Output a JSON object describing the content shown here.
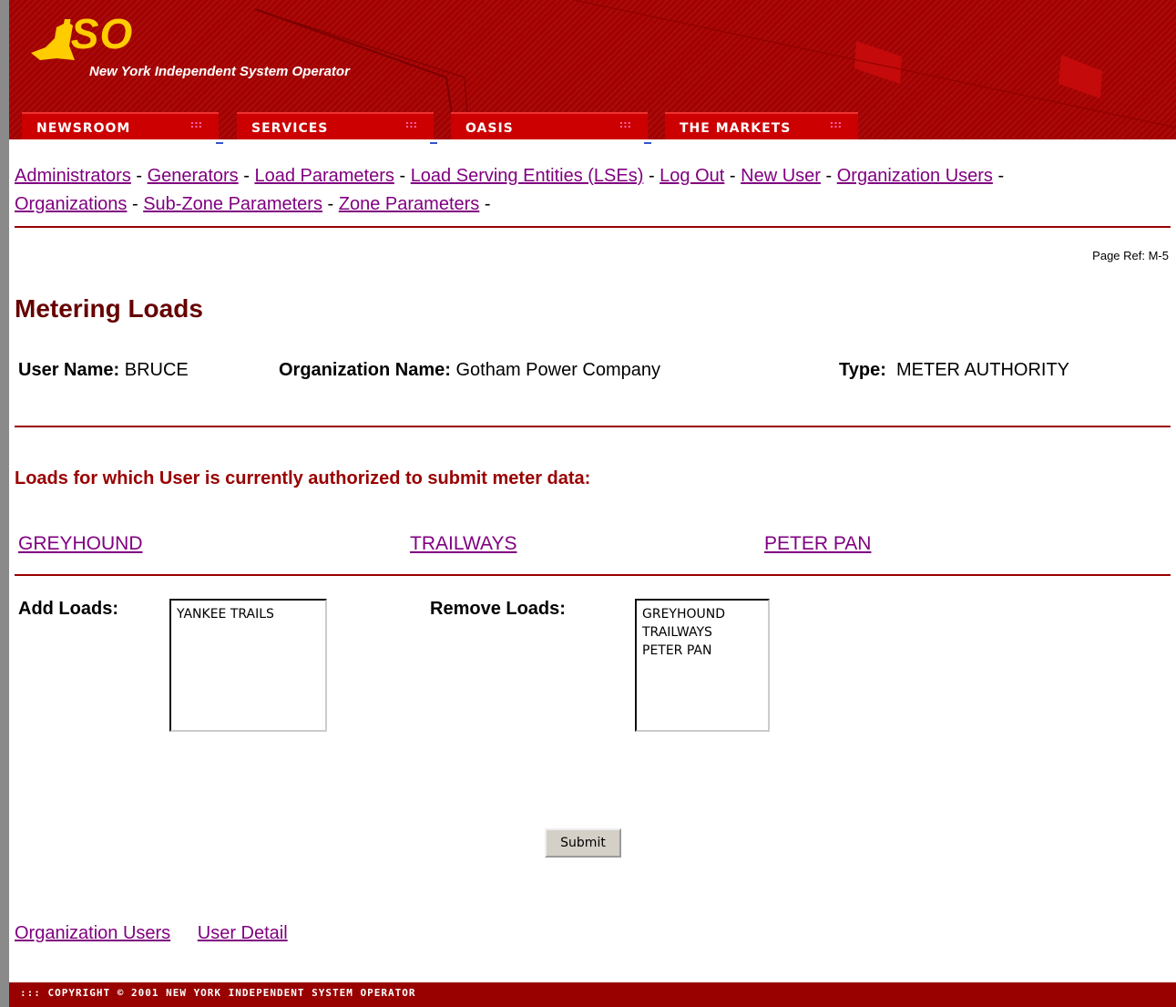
{
  "header": {
    "logo_text": "ISO",
    "tagline": "New York Independent System Operator",
    "tabs": [
      {
        "label": "NEWSROOM"
      },
      {
        "label": "SERVICES"
      },
      {
        "label": "OASIS"
      },
      {
        "label": "THE MARKETS"
      }
    ],
    "tab_dots": ":::"
  },
  "nav": {
    "links": [
      "Administrators",
      "Generators",
      "Load Parameters",
      "Load Serving Entities (LSEs)",
      "Log Out",
      "New User",
      "Organization Users",
      "Organizations",
      "Sub-Zone Parameters",
      "Zone Parameters"
    ],
    "separator": "-"
  },
  "page_ref": "Page Ref: M-5",
  "title": "Metering Loads",
  "info": {
    "user_label": "User Name:",
    "user_value": "BRUCE",
    "org_label": "Organization Name:",
    "org_value": "Gotham Power Company",
    "type_label": "Type:",
    "type_value": "METER AUTHORITY"
  },
  "authorized": {
    "heading": "Loads for which User is currently authorized to submit meter data:",
    "loads": [
      "GREYHOUND",
      "TRAILWAYS",
      "PETER PAN"
    ]
  },
  "add_loads": {
    "label": "Add Loads:",
    "options": [
      "YANKEE TRAILS"
    ]
  },
  "remove_loads": {
    "label": "Remove Loads:",
    "options": [
      "GREYHOUND",
      "TRAILWAYS",
      "PETER PAN"
    ]
  },
  "submit_label": "Submit",
  "bottom_links": [
    "Organization Users",
    "User Detail"
  ],
  "footer": "::: COPYRIGHT © 2001 NEW YORK INDEPENDENT SYSTEM OPERATOR",
  "colors": {
    "header_red": "#a30000",
    "tab_red": "#cc0000",
    "rule": "#990000",
    "title": "#660000",
    "link_visited": "#800080",
    "logo_yellow": "#ffcc00"
  }
}
